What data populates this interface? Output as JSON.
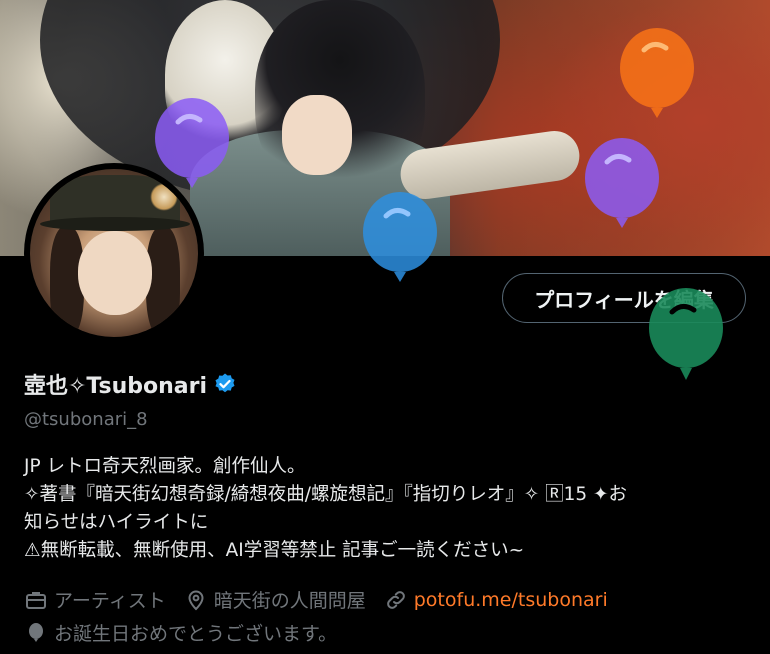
{
  "profile": {
    "display_name": "壺也✧Tsubonari",
    "handle": "@tsubonari_8",
    "edit_button_label": "プロフィールを編集",
    "bio_lines": [
      "JP  レトロ奇天烈画家。創作仙人。",
      "✧著書『暗天街幻想奇録/綺想夜曲/螺旋想記』『指切りレオ』✧ 🅁15 ✦お",
      "知らせはハイライトに",
      "⚠無断転載、無断使用、AI学習等禁止 記事ご一読ください~"
    ],
    "category": "アーティスト",
    "location": "暗天街の人間問屋",
    "website": "potofu.me/tsubonari",
    "birthday_text": "お誕生日おめでとうございます。"
  },
  "icons": {
    "verified": "verified-badge-icon",
    "category": "briefcase-icon",
    "location": "location-pin-icon",
    "website": "link-icon",
    "birthday": "balloon-icon"
  },
  "colors": {
    "background": "#000000",
    "primary_text": "#e7e9ea",
    "secondary_text": "#71767b",
    "link": "#ff7a29",
    "verified": "#1d9bf0",
    "balloons": [
      "#8b5cf6",
      "#f97316",
      "#2d8fe0",
      "#1a8a5a"
    ]
  }
}
